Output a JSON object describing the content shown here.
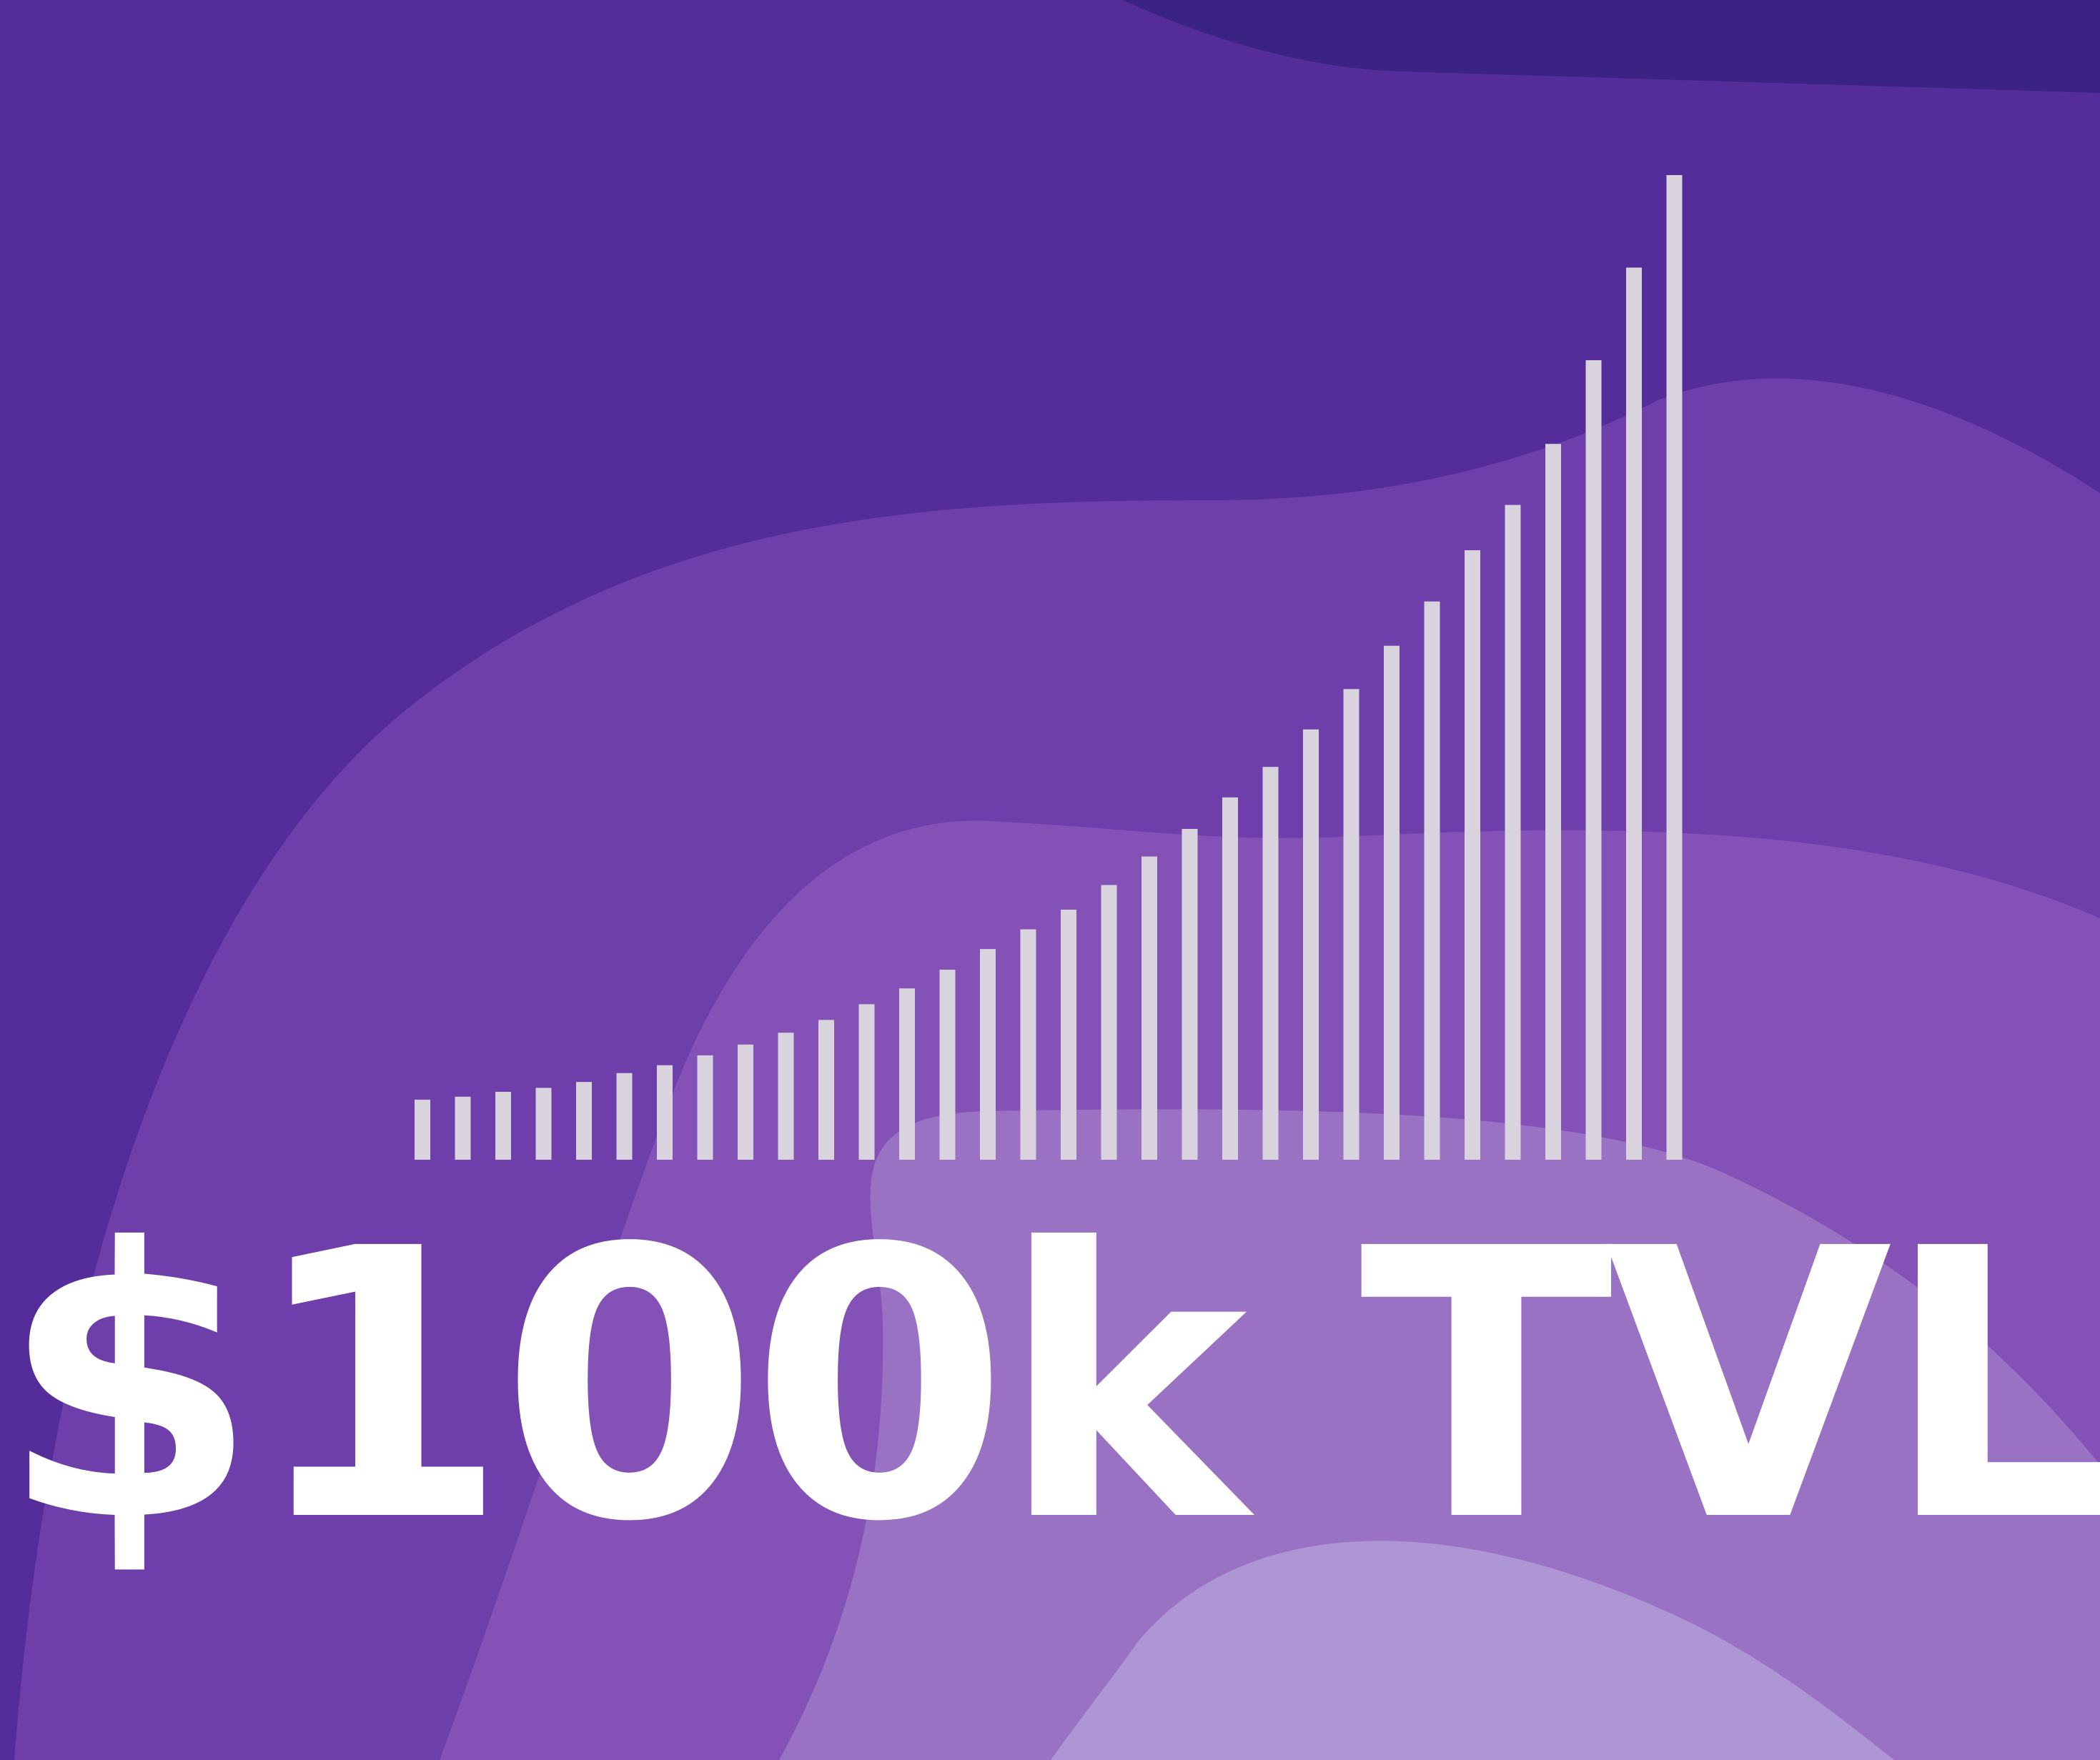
{
  "headline": "$100k TVL",
  "colors": {
    "band_darkest": "#3b2384",
    "band_dark": "#552d9a",
    "band_mid": "#6e3fab",
    "band_light": "#8451b7",
    "band_lighter": "#9a72c4",
    "band_lightest": "#ae95d4",
    "bars": "#d8d3dd",
    "headline": "#ffffff"
  },
  "chart_data": {
    "type": "bar",
    "title": "",
    "xlabel": "",
    "ylabel": "",
    "grid": false,
    "ylim": [
      0,
      100
    ],
    "values": [
      6.1,
      6.4,
      6.9,
      7.3,
      7.9,
      8.8,
      9.6,
      10.6,
      11.7,
      12.9,
      14.2,
      15.8,
      17.4,
      19.3,
      21.4,
      23.4,
      25.4,
      27.9,
      30.8,
      33.6,
      36.8,
      39.9,
      43.7,
      47.8,
      52.2,
      56.7,
      61.9,
      66.5,
      72.7,
      81.2,
      90.6,
      100
    ]
  }
}
